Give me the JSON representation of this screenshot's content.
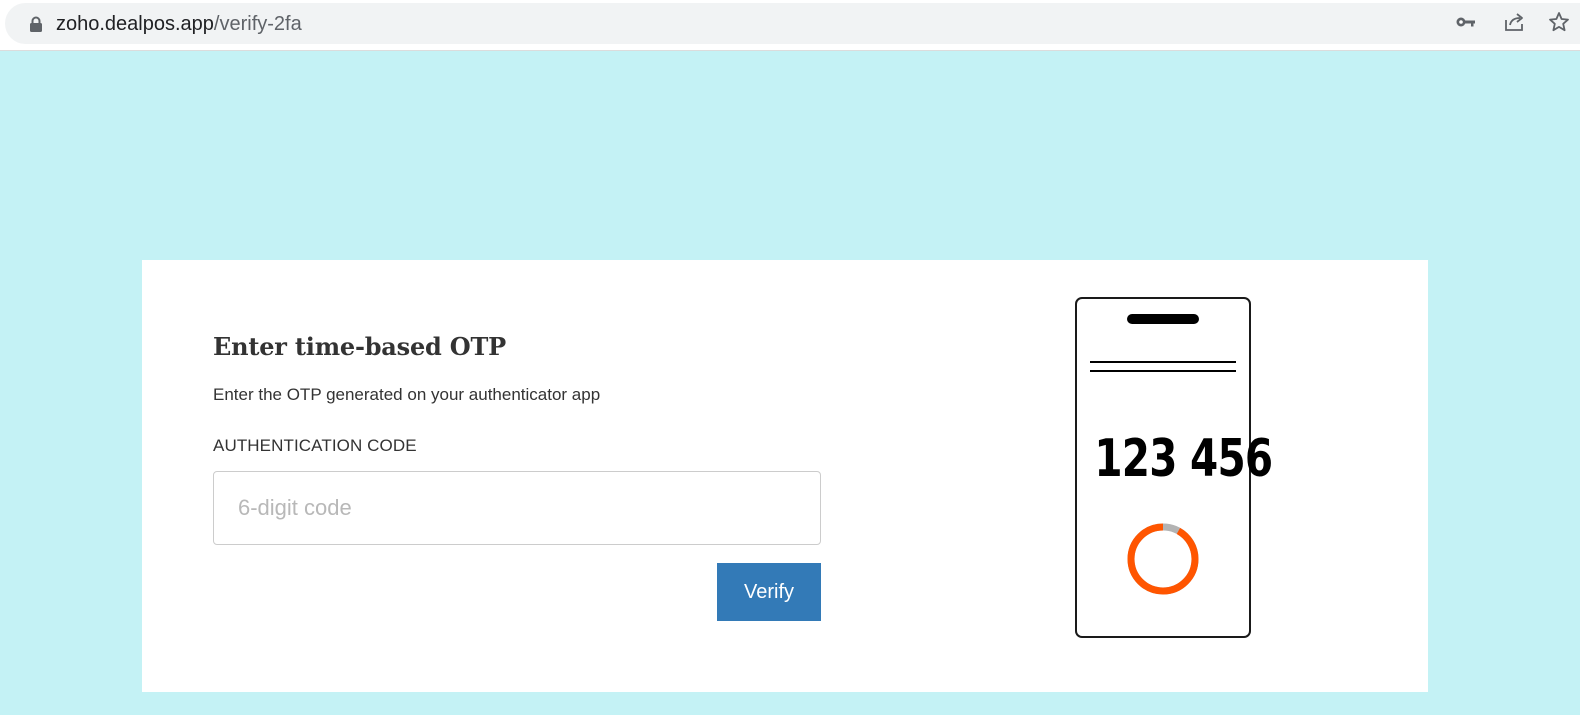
{
  "browser": {
    "url_host": "zoho.dealpos.app",
    "url_path": "/verify-2fa",
    "icons": {
      "lock": "lock-icon",
      "key": "key-icon",
      "share": "share-icon",
      "bookmark": "star-icon"
    }
  },
  "page": {
    "background_color": "#c4f2f5",
    "heading": "Enter time-based OTP",
    "subtext": "Enter the OTP generated on your authenticator app",
    "field_label": "AUTHENTICATION CODE",
    "code_input": {
      "value": "",
      "placeholder": "6-digit code"
    },
    "verify_label": "Verify",
    "accent_color": "#337ab7"
  },
  "illustration": {
    "otp_display": "123 456",
    "timer_color": "#ff5500",
    "timer_remaining_fraction": 0.92
  }
}
